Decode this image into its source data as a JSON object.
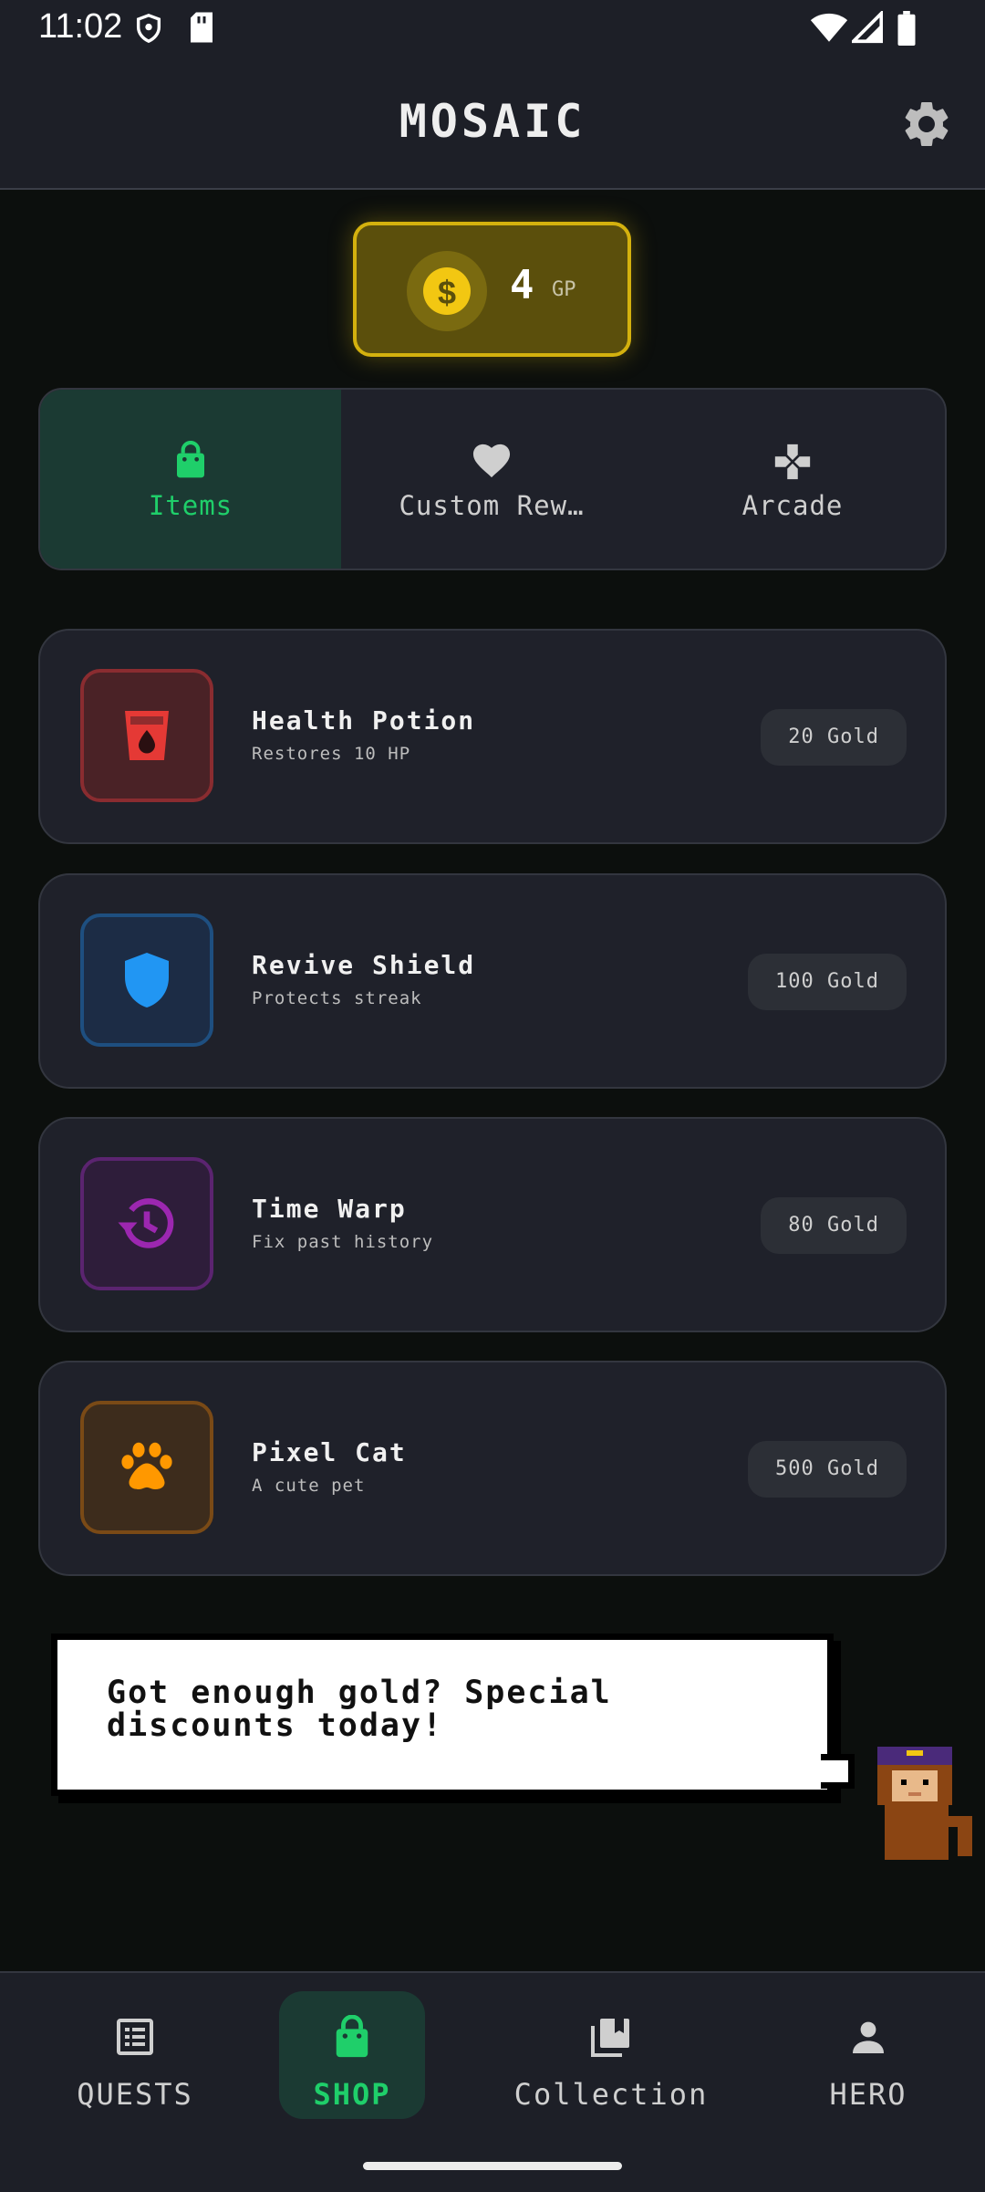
{
  "status_bar": {
    "time": "11:02"
  },
  "header": {
    "title": "MOSAIC"
  },
  "gold": {
    "amount": "4",
    "unit": "GP"
  },
  "tabs": [
    {
      "label": "Items",
      "icon": "shopping-bag-icon",
      "active": true
    },
    {
      "label": "Custom Rew…",
      "icon": "heart-icon",
      "active": false
    },
    {
      "label": "Arcade",
      "icon": "gamepad-icon",
      "active": false
    }
  ],
  "items": [
    {
      "name": "Health Potion",
      "description": "Restores 10 HP",
      "price": "20 Gold",
      "icon": "potion-icon",
      "color": "#e53935"
    },
    {
      "name": "Revive Shield",
      "description": "Protects streak",
      "price": "100 Gold",
      "icon": "shield-icon",
      "color": "#2196f3"
    },
    {
      "name": "Time Warp",
      "description": "Fix past history",
      "price": "80 Gold",
      "icon": "history-icon",
      "color": "#9c27b0"
    },
    {
      "name": "Pixel Cat",
      "description": "A cute pet",
      "price": "500 Gold",
      "icon": "paw-icon",
      "color": "#ff9800"
    }
  ],
  "speech": {
    "text": "Got enough gold? Special discounts today!"
  },
  "nav": [
    {
      "label": "QUESTS",
      "icon": "list-icon",
      "active": false
    },
    {
      "label": "SHOP",
      "icon": "shopping-bag-icon",
      "active": true
    },
    {
      "label": "Collection",
      "icon": "collection-icon",
      "active": false
    },
    {
      "label": "HERO",
      "icon": "person-icon",
      "active": false
    }
  ],
  "colors": {
    "accent_green": "#1fcf6a",
    "gold": "#d4b10e",
    "background": "#0c0f0d",
    "card": "#1f212a"
  }
}
